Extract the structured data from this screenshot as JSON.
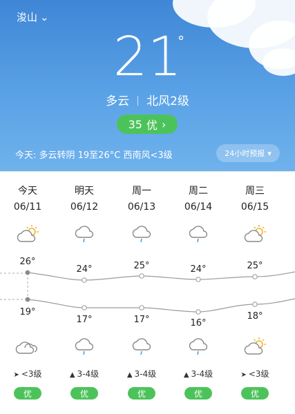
{
  "header": {
    "location": "浚山",
    "temperature": "21",
    "degree_symbol": "°",
    "condition": "多云",
    "wind": "北风2级",
    "aqi_value": "35",
    "aqi_label": "优",
    "today_summary": "今天: 多云转阴 19至26°C 西南风<3级",
    "forecast_button": "24小时预报"
  },
  "days": [
    {
      "name": "今天",
      "date": "06/11",
      "high": "26°",
      "low": "19°",
      "day_icon": "partly-cloudy-sun-icon",
      "night_icon": "cloudy-icon",
      "wind": "<3级",
      "air": "优"
    },
    {
      "name": "明天",
      "date": "06/12",
      "high": "24°",
      "low": "17°",
      "day_icon": "light-rain-icon",
      "night_icon": "light-rain-icon",
      "wind": "3-4级",
      "air": "优"
    },
    {
      "name": "周一",
      "date": "06/13",
      "high": "25°",
      "low": "17°",
      "day_icon": "light-rain-icon",
      "night_icon": "light-rain-icon",
      "wind": "3-4级",
      "air": "优"
    },
    {
      "name": "周二",
      "date": "06/14",
      "high": "24°",
      "low": "16°",
      "day_icon": "light-rain-icon",
      "night_icon": "light-rain-icon",
      "wind": "3-4级",
      "air": "优"
    },
    {
      "name": "周三",
      "date": "06/15",
      "high": "25°",
      "low": "18°",
      "day_icon": "partly-cloudy-sun-icon",
      "night_icon": "partly-cloudy-sun-icon",
      "wind": "<3级",
      "air": "优"
    }
  ],
  "colors": {
    "sky": "#4a8fdc",
    "aqi_good": "#4cc35a",
    "line": "#9a9a9a"
  }
}
